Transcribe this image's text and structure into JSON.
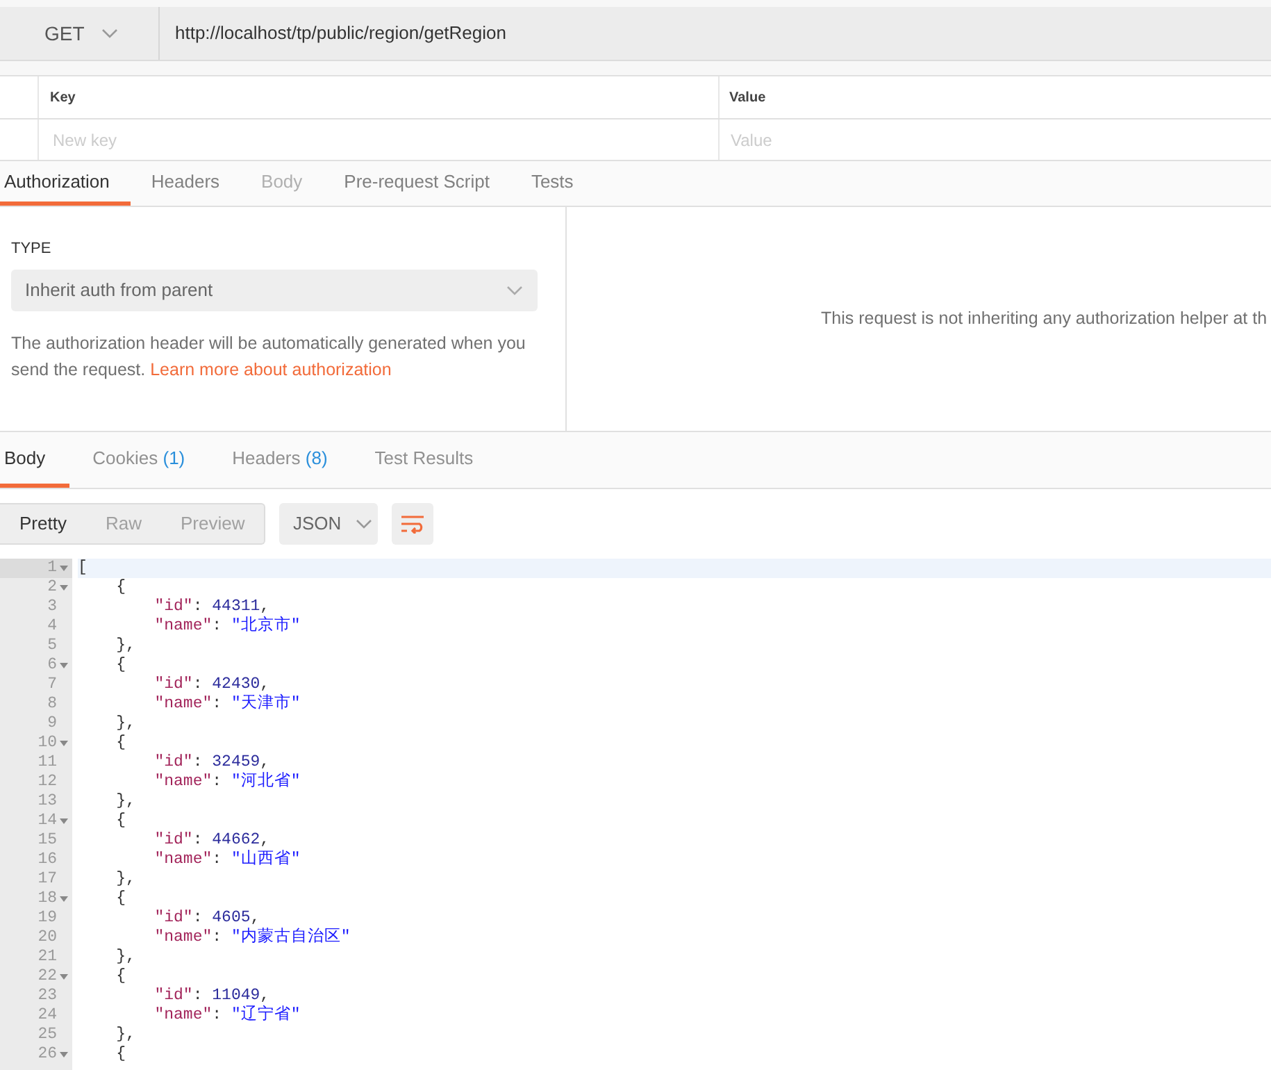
{
  "request": {
    "method": "GET",
    "url": "http://localhost/tp/public/region/getRegion"
  },
  "params": {
    "columns": [
      "Key",
      "Value"
    ],
    "new_row": {
      "key_placeholder": "New key",
      "value_placeholder": "Value"
    }
  },
  "request_tabs": [
    {
      "label": "Authorization",
      "selected": true,
      "disabled": false
    },
    {
      "label": "Headers",
      "selected": false,
      "disabled": false
    },
    {
      "label": "Body",
      "selected": false,
      "disabled": true
    },
    {
      "label": "Pre-request Script",
      "selected": false,
      "disabled": false
    },
    {
      "label": "Tests",
      "selected": false,
      "disabled": false
    }
  ],
  "auth": {
    "type_label": "TYPE",
    "type_value": "Inherit auth from parent",
    "description": "The authorization header will be automatically generated when you send the request.",
    "link": "Learn more about authorization",
    "message": "This request is not inheriting any authorization helper at th"
  },
  "response_tabs": [
    {
      "label": "Body",
      "selected": true
    },
    {
      "label": "Cookies",
      "count": "(1)",
      "selected": false
    },
    {
      "label": "Headers",
      "count": "(8)",
      "selected": false
    },
    {
      "label": "Test Results",
      "selected": false
    }
  ],
  "view_modes": [
    {
      "label": "Pretty",
      "selected": true
    },
    {
      "label": "Raw",
      "selected": false
    },
    {
      "label": "Preview",
      "selected": false
    }
  ],
  "format": "JSON",
  "code_lines": [
    {
      "number": "1",
      "fold": true,
      "tokens": [
        {
          "kind": "punct",
          "text": "["
        }
      ]
    },
    {
      "number": "2",
      "fold": true,
      "tokens": [
        {
          "kind": "punct",
          "text": "    {"
        }
      ]
    },
    {
      "number": "3",
      "fold": false,
      "tokens": [
        {
          "kind": "key",
          "text": "        \"id\""
        },
        {
          "kind": "punct",
          "text": ": "
        },
        {
          "kind": "number",
          "text": "44311"
        },
        {
          "kind": "punct",
          "text": ","
        }
      ]
    },
    {
      "number": "4",
      "fold": false,
      "tokens": [
        {
          "kind": "key",
          "text": "        \"name\""
        },
        {
          "kind": "punct",
          "text": ": "
        },
        {
          "kind": "string",
          "text": "\"北京市\""
        }
      ]
    },
    {
      "number": "5",
      "fold": false,
      "tokens": [
        {
          "kind": "punct",
          "text": "    },"
        }
      ]
    },
    {
      "number": "6",
      "fold": true,
      "tokens": [
        {
          "kind": "punct",
          "text": "    {"
        }
      ]
    },
    {
      "number": "7",
      "fold": false,
      "tokens": [
        {
          "kind": "key",
          "text": "        \"id\""
        },
        {
          "kind": "punct",
          "text": ": "
        },
        {
          "kind": "number",
          "text": "42430"
        },
        {
          "kind": "punct",
          "text": ","
        }
      ]
    },
    {
      "number": "8",
      "fold": false,
      "tokens": [
        {
          "kind": "key",
          "text": "        \"name\""
        },
        {
          "kind": "punct",
          "text": ": "
        },
        {
          "kind": "string",
          "text": "\"天津市\""
        }
      ]
    },
    {
      "number": "9",
      "fold": false,
      "tokens": [
        {
          "kind": "punct",
          "text": "    },"
        }
      ]
    },
    {
      "number": "10",
      "fold": true,
      "tokens": [
        {
          "kind": "punct",
          "text": "    {"
        }
      ]
    },
    {
      "number": "11",
      "fold": false,
      "tokens": [
        {
          "kind": "key",
          "text": "        \"id\""
        },
        {
          "kind": "punct",
          "text": ": "
        },
        {
          "kind": "number",
          "text": "32459"
        },
        {
          "kind": "punct",
          "text": ","
        }
      ]
    },
    {
      "number": "12",
      "fold": false,
      "tokens": [
        {
          "kind": "key",
          "text": "        \"name\""
        },
        {
          "kind": "punct",
          "text": ": "
        },
        {
          "kind": "string",
          "text": "\"河北省\""
        }
      ]
    },
    {
      "number": "13",
      "fold": false,
      "tokens": [
        {
          "kind": "punct",
          "text": "    },"
        }
      ]
    },
    {
      "number": "14",
      "fold": true,
      "tokens": [
        {
          "kind": "punct",
          "text": "    {"
        }
      ]
    },
    {
      "number": "15",
      "fold": false,
      "tokens": [
        {
          "kind": "key",
          "text": "        \"id\""
        },
        {
          "kind": "punct",
          "text": ": "
        },
        {
          "kind": "number",
          "text": "44662"
        },
        {
          "kind": "punct",
          "text": ","
        }
      ]
    },
    {
      "number": "16",
      "fold": false,
      "tokens": [
        {
          "kind": "key",
          "text": "        \"name\""
        },
        {
          "kind": "punct",
          "text": ": "
        },
        {
          "kind": "string",
          "text": "\"山西省\""
        }
      ]
    },
    {
      "number": "17",
      "fold": false,
      "tokens": [
        {
          "kind": "punct",
          "text": "    },"
        }
      ]
    },
    {
      "number": "18",
      "fold": true,
      "tokens": [
        {
          "kind": "punct",
          "text": "    {"
        }
      ]
    },
    {
      "number": "19",
      "fold": false,
      "tokens": [
        {
          "kind": "key",
          "text": "        \"id\""
        },
        {
          "kind": "punct",
          "text": ": "
        },
        {
          "kind": "number",
          "text": "4605"
        },
        {
          "kind": "punct",
          "text": ","
        }
      ]
    },
    {
      "number": "20",
      "fold": false,
      "tokens": [
        {
          "kind": "key",
          "text": "        \"name\""
        },
        {
          "kind": "punct",
          "text": ": "
        },
        {
          "kind": "string",
          "text": "\"内蒙古自治区\""
        }
      ]
    },
    {
      "number": "21",
      "fold": false,
      "tokens": [
        {
          "kind": "punct",
          "text": "    },"
        }
      ]
    },
    {
      "number": "22",
      "fold": true,
      "tokens": [
        {
          "kind": "punct",
          "text": "    {"
        }
      ]
    },
    {
      "number": "23",
      "fold": false,
      "tokens": [
        {
          "kind": "key",
          "text": "        \"id\""
        },
        {
          "kind": "punct",
          "text": ": "
        },
        {
          "kind": "number",
          "text": "11049"
        },
        {
          "kind": "punct",
          "text": ","
        }
      ]
    },
    {
      "number": "24",
      "fold": false,
      "tokens": [
        {
          "kind": "key",
          "text": "        \"name\""
        },
        {
          "kind": "punct",
          "text": ": "
        },
        {
          "kind": "string",
          "text": "\"辽宁省\""
        }
      ]
    },
    {
      "number": "25",
      "fold": false,
      "tokens": [
        {
          "kind": "punct",
          "text": "    },"
        }
      ]
    },
    {
      "number": "26",
      "fold": true,
      "tokens": [
        {
          "kind": "punct",
          "text": "    {"
        }
      ]
    }
  ]
}
